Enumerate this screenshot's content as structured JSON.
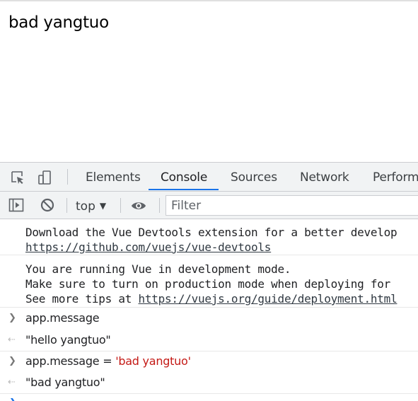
{
  "page": {
    "heading": "bad yangtuo"
  },
  "devtools": {
    "tabs": [
      {
        "label": "Elements"
      },
      {
        "label": "Console"
      },
      {
        "label": "Sources"
      },
      {
        "label": "Network"
      },
      {
        "label": "Perform"
      }
    ],
    "active_tab": "Console",
    "toolbar": {
      "context": "top",
      "filter_placeholder": "Filter"
    },
    "messages": {
      "vue_devtools": {
        "line1": "Download the Vue Devtools extension for a better develop",
        "link": "https://github.com/vuejs/vue-devtools"
      },
      "dev_mode": {
        "line1": "You are running Vue in development mode.",
        "line2": "Make sure to turn on production mode when deploying for",
        "line3_prefix": "See more tips at ",
        "line3_link": "https://vuejs.org/guide/deployment.html"
      },
      "entry1": {
        "input": "app.message",
        "output": "\"hello yangtuo\""
      },
      "entry2": {
        "input_code": "app.message = ",
        "input_string": "'bad yangtuo'",
        "output": "\"bad yangtuo\""
      }
    }
  }
}
